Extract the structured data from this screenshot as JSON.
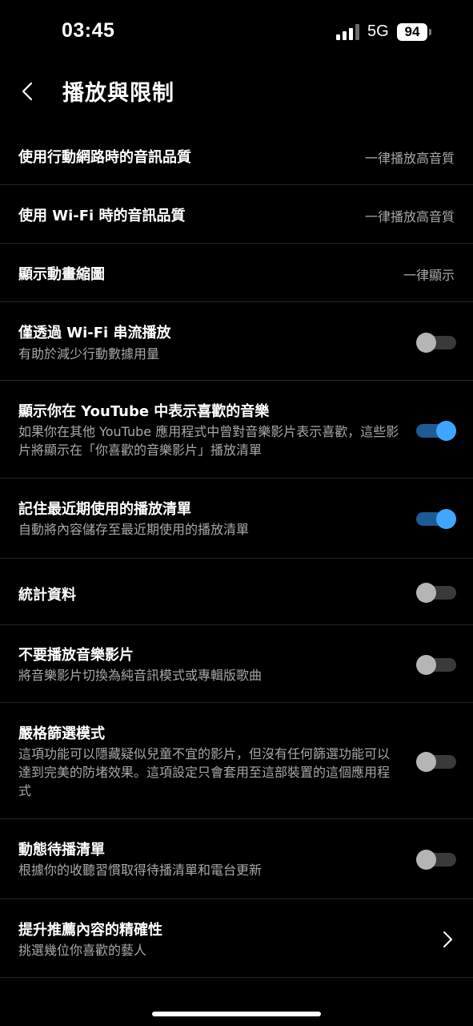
{
  "status_bar": {
    "time": "03:45",
    "network": "5G",
    "battery": "94"
  },
  "header": {
    "title": "播放與限制"
  },
  "settings": [
    {
      "title": "使用行動網路時的音訊品質",
      "value": "一律播放高音質"
    },
    {
      "title": "使用 Wi-Fi 時的音訊品質",
      "value": "一律播放高音質"
    },
    {
      "title": "顯示動畫縮圖",
      "value": "一律顯示"
    },
    {
      "title": "僅透過 Wi-Fi 串流播放",
      "subtitle": "有助於減少行動數據用量",
      "toggle": false
    },
    {
      "title": "顯示你在 YouTube 中表示喜歡的音樂",
      "subtitle": "如果你在其他 YouTube 應用程式中曾對音樂影片表示喜歡，這些影片將顯示在「你喜歡的音樂影片」播放清單",
      "toggle": true
    },
    {
      "title": "記住最近期使用的播放清單",
      "subtitle": "自動將內容儲存至最近期使用的播放清單",
      "toggle": true
    },
    {
      "title": "統計資料",
      "toggle": false
    },
    {
      "title": "不要播放音樂影片",
      "subtitle": "將音樂影片切換為純音訊模式或專輯版歌曲",
      "toggle": false
    },
    {
      "title": "嚴格篩選模式",
      "subtitle": "這項功能可以隱藏疑似兒童不宜的影片，但沒有任何篩選功能可以達到完美的防堵效果。這項設定只會套用至這部裝置的這個應用程式",
      "toggle": false
    },
    {
      "title": "動態待播清單",
      "subtitle": "根據你的收聽習慣取得待播清單和電台更新",
      "toggle": false
    },
    {
      "title": "提升推薦內容的精確性",
      "subtitle": "挑選幾位你喜歡的藝人"
    }
  ],
  "colors": {
    "background": "#000000",
    "toggle_on": "#3ea6ff",
    "toggle_off": "#b5b5b5",
    "secondary_text": "#a8a8a8"
  },
  "icons": [
    "signal-icon",
    "battery-icon",
    "back-arrow-icon",
    "chevron-right-icon"
  ]
}
